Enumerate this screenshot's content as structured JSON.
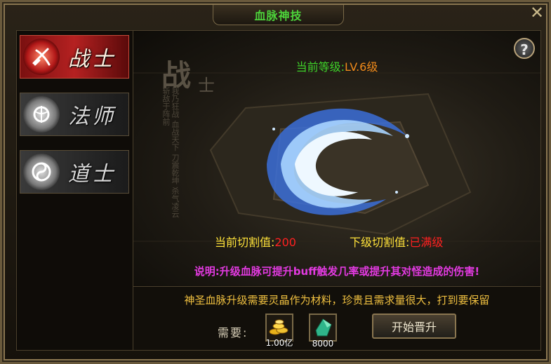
{
  "window": {
    "title": "血脉神技",
    "close_glyph": "✕"
  },
  "sidebar": {
    "items": [
      {
        "label": "战士",
        "icon": "warrior-emblem-icon",
        "active": true
      },
      {
        "label": "法师",
        "icon": "mage-emblem-icon",
        "active": false
      },
      {
        "label": "道士",
        "icon": "taoist-emblem-icon",
        "active": false
      }
    ]
  },
  "main": {
    "help_glyph": "?",
    "calligraphy": {
      "big": "战",
      "small": "士",
      "poem": "我乃狂战 血战天下 刀震乾坤 杀气凌云 斩敌于阵前"
    },
    "level": {
      "label": "当前等级:",
      "value": "LV.6级"
    },
    "current_cut": {
      "label": "当前切割值:",
      "value": "200"
    },
    "next_cut": {
      "label": "下级切割值:",
      "value": "已满级"
    },
    "note": "说明:升级血脉可提升buff触发几率或提升其对怪造成的伤害!"
  },
  "bottom": {
    "requirement_text": "神圣血脉升级需要灵晶作为材料，珍贵且需求量很大，打到要保留",
    "need_label": "需要:",
    "costs": [
      {
        "icon": "gold-coins-icon",
        "qty": "1.00亿"
      },
      {
        "icon": "spirit-crystal-icon",
        "qty": "8000"
      }
    ],
    "upgrade_button": "开始晋升"
  },
  "colors": {
    "title_green": "#4cd23a",
    "value_orange": "#f08a1a",
    "value_red": "#ff2020",
    "note_magenta": "#e23ae0",
    "active_red": "#b52121"
  }
}
